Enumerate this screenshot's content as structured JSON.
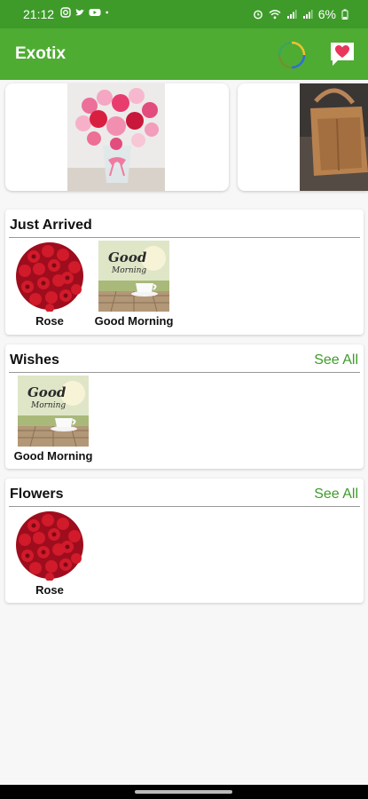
{
  "status_bar": {
    "time": "21:12",
    "battery": "6%",
    "left_icons": [
      "instagram-icon",
      "twitter-icon",
      "youtube-icon",
      "dot-icon"
    ],
    "right_icons": [
      "alarm-icon",
      "wifi-icon",
      "signal-icon",
      "signal-icon",
      "battery-icon"
    ]
  },
  "app_bar": {
    "title": "Exotix",
    "icons": [
      "loading-spinner-icon",
      "favorites-heart-icon"
    ],
    "colors": {
      "status_bar": "#3e9b2a",
      "app_bar": "#4fac33",
      "accent": "#3e9b2a"
    }
  },
  "banners": [
    {
      "image": "flower-bouquet-image"
    },
    {
      "image": "handbag-image"
    }
  ],
  "sections": [
    {
      "title": "Just Arrived",
      "see_all": "",
      "items": [
        {
          "label": "Rose",
          "image": "red-roses-image"
        },
        {
          "label": "Good Morning",
          "image": "good-morning-coffee-image"
        }
      ]
    },
    {
      "title": "Wishes",
      "see_all": "See All",
      "items": [
        {
          "label": "Good Morning",
          "image": "good-morning-coffee-image"
        }
      ]
    },
    {
      "title": "Flowers",
      "see_all": "See All",
      "items": [
        {
          "label": "Rose",
          "image": "red-roses-image"
        }
      ]
    }
  ]
}
